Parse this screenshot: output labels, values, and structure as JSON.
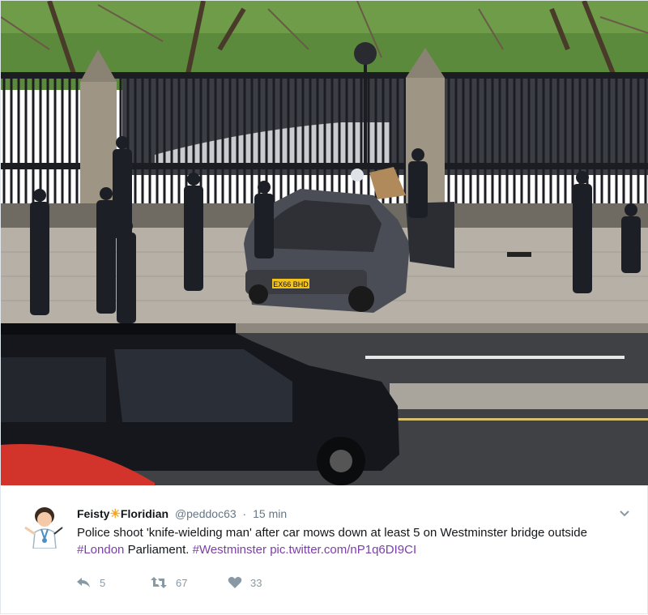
{
  "tweet": {
    "author_first": "Feisty",
    "author_emoji": "☀",
    "author_last": "Floridian",
    "handle": "@peddoc63",
    "separator": "·",
    "timestamp": "15 min",
    "text_part1": "Police shoot 'knife-wielding man' after car mows down at least 5 on Westminster bridge outside ",
    "hashtag1": "#London",
    "text_part2": " Parliament. ",
    "hashtag2": "#Westminster",
    "text_space": " ",
    "media_link": "pic.twitter.com/nP1q6DI9CI"
  },
  "actions": {
    "reply_count": "5",
    "retweet_count": "67",
    "like_count": "33"
  },
  "photo": {
    "plate_text": "EX66 BHD"
  },
  "colors": {
    "link": "#7b3fa8",
    "text": "#14171a",
    "muted": "#657786",
    "icon": "#8899a6"
  },
  "icons": [
    "reply-icon",
    "retweet-icon",
    "like-icon",
    "chevron-down-icon",
    "sun-emoji"
  ]
}
